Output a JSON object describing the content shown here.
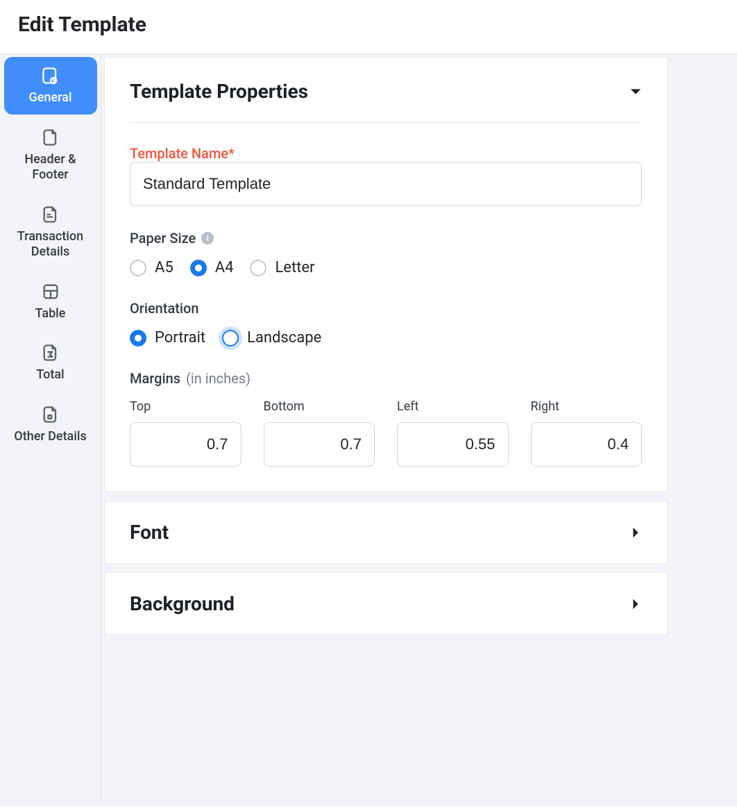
{
  "page_title": "Edit Template",
  "sidebar": {
    "items": [
      {
        "label": "General",
        "active": true
      },
      {
        "label": "Header & Footer",
        "active": false
      },
      {
        "label": "Transaction Details",
        "active": false
      },
      {
        "label": "Table",
        "active": false
      },
      {
        "label": "Total",
        "active": false
      },
      {
        "label": "Other Details",
        "active": false
      }
    ]
  },
  "panels": {
    "template_properties": {
      "title": "Template Properties",
      "expanded": true,
      "template_name_label": "Template Name*",
      "template_name_value": "Standard Template",
      "paper_size": {
        "label": "Paper Size",
        "options": [
          "A5",
          "A4",
          "Letter"
        ],
        "selected": "A4"
      },
      "orientation": {
        "label": "Orientation",
        "options": [
          "Portrait",
          "Landscape"
        ],
        "selected": "Portrait",
        "focused": "Landscape"
      },
      "margins": {
        "label": "Margins",
        "hint": "(in inches)",
        "fields": {
          "top": {
            "label": "Top",
            "value": "0.7"
          },
          "bottom": {
            "label": "Bottom",
            "value": "0.7"
          },
          "left": {
            "label": "Left",
            "value": "0.55"
          },
          "right": {
            "label": "Right",
            "value": "0.4"
          }
        }
      }
    },
    "font": {
      "title": "Font",
      "expanded": false
    },
    "background": {
      "title": "Background",
      "expanded": false
    }
  }
}
